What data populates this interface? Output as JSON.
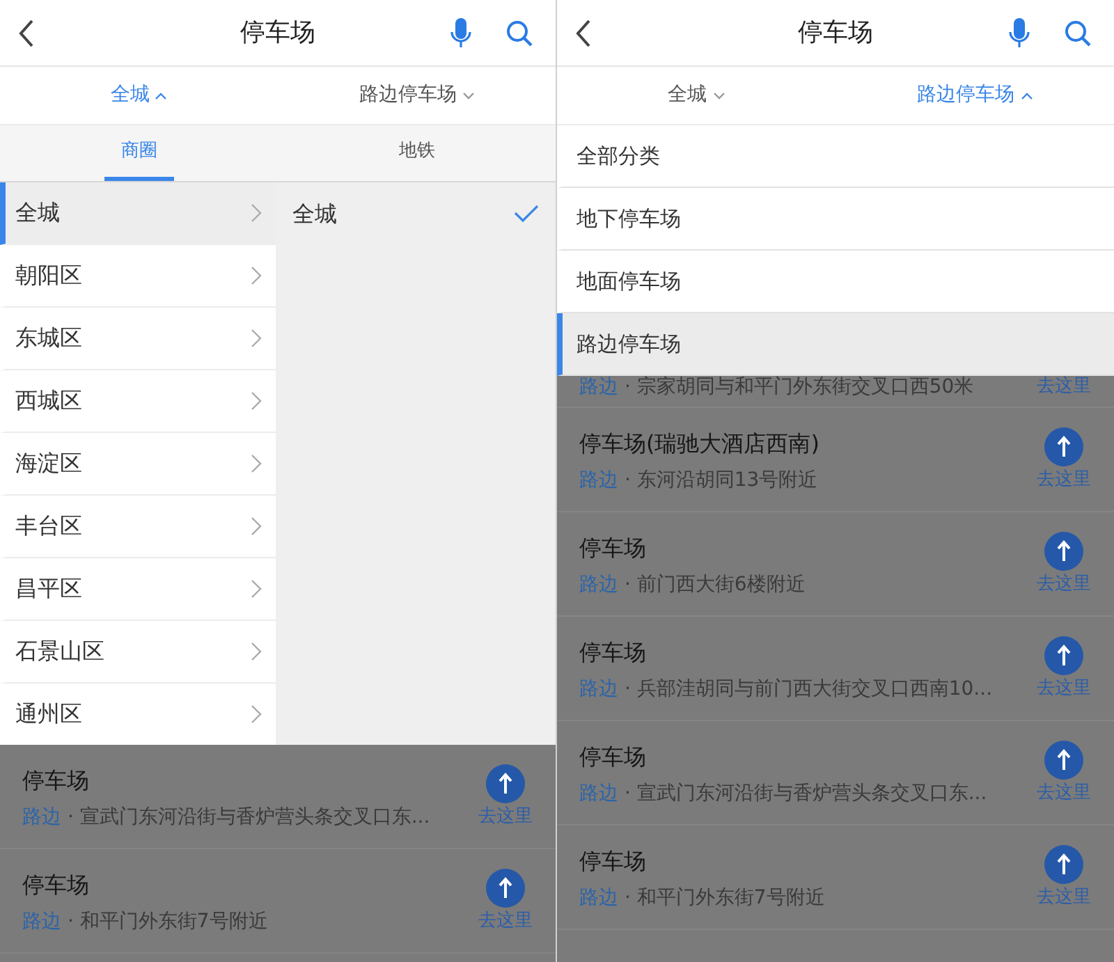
{
  "panels": [
    {
      "header": {
        "title": "停车场"
      },
      "filters": [
        {
          "label": "全城",
          "expanded": true
        },
        {
          "label": "路边停车场",
          "expanded": false
        }
      ],
      "dropdown": {
        "kind": "district",
        "tabs": [
          {
            "label": "商圈",
            "selected": true
          },
          {
            "label": "地铁",
            "selected": false
          }
        ],
        "districts": [
          {
            "label": "全城",
            "selected": true
          },
          {
            "label": "朝阳区",
            "selected": false
          },
          {
            "label": "东城区",
            "selected": false
          },
          {
            "label": "西城区",
            "selected": false
          },
          {
            "label": "海淀区",
            "selected": false
          },
          {
            "label": "丰台区",
            "selected": false
          },
          {
            "label": "昌平区",
            "selected": false
          },
          {
            "label": "石景山区",
            "selected": false
          },
          {
            "label": "通州区",
            "selected": false
          }
        ],
        "areas": [
          {
            "label": "全城",
            "selected": true
          }
        ]
      },
      "results": [
        {
          "title": "停车场",
          "tag": "路边",
          "address": "· 宣武门东河沿街与香炉营头条交叉口东...",
          "action": "去这里"
        },
        {
          "title": "停车场",
          "tag": "路边",
          "address": "· 和平门外东街7号附近",
          "action": "去这里"
        }
      ]
    },
    {
      "header": {
        "title": "停车场"
      },
      "filters": [
        {
          "label": "全城",
          "expanded": false
        },
        {
          "label": "路边停车场",
          "expanded": true
        }
      ],
      "dropdown": {
        "kind": "category",
        "options": [
          {
            "label": "全部分类",
            "selected": false
          },
          {
            "label": "地下停车场",
            "selected": false
          },
          {
            "label": "地面停车场",
            "selected": false
          },
          {
            "label": "路边停车场",
            "selected": true
          }
        ]
      },
      "results": [
        {
          "tag": "路边",
          "address": "· 宗家胡同与和平门外东街交叉口西50米",
          "action": "去这里"
        },
        {
          "title": "停车场(瑞驰大酒店西南)",
          "tag": "路边",
          "address": "· 东河沿胡同13号附近",
          "action": "去这里"
        },
        {
          "title": "停车场",
          "tag": "路边",
          "address": "· 前门西大街6楼附近",
          "action": "去这里"
        },
        {
          "title": "停车场",
          "tag": "路边",
          "address": "· 兵部洼胡同与前门西大街交叉口西南10...",
          "action": "去这里"
        },
        {
          "title": "停车场",
          "tag": "路边",
          "address": "· 宣武门东河沿街与香炉营头条交叉口东...",
          "action": "去这里"
        },
        {
          "title": "停车场",
          "tag": "路边",
          "address": "· 和平门外东街7号附近",
          "action": "去这里"
        }
      ]
    }
  ]
}
